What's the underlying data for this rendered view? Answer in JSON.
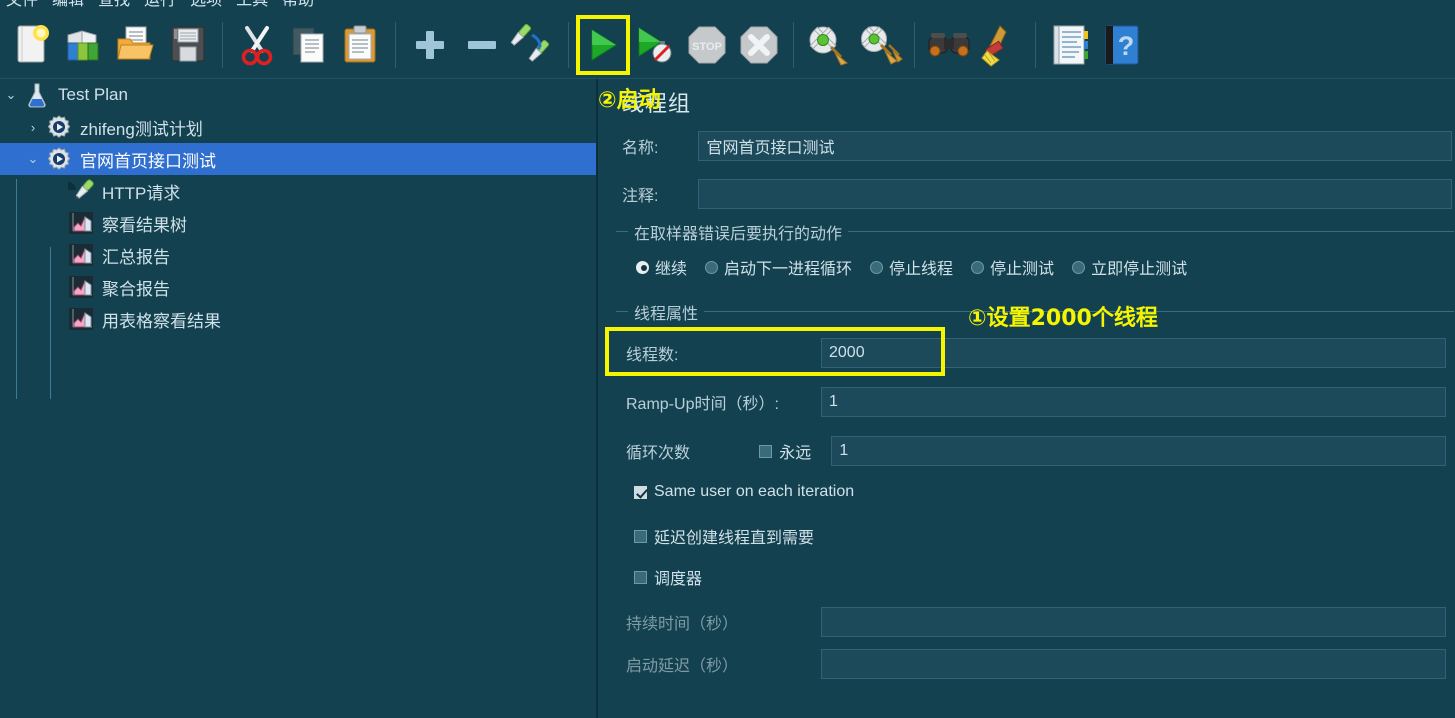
{
  "menu": {
    "items": [
      "文件",
      "编辑",
      "查找",
      "运行",
      "选项",
      "工具",
      "帮助"
    ]
  },
  "toolbar": {
    "buttons": [
      {
        "name": "new-icon",
        "label": "新建"
      },
      {
        "name": "templates-icon",
        "label": "模板"
      },
      {
        "name": "open-icon",
        "label": "打开"
      },
      {
        "name": "save-icon",
        "label": "保存"
      },
      {
        "name": "cut-icon",
        "label": "剪切"
      },
      {
        "name": "copy-icon",
        "label": "复制"
      },
      {
        "name": "paste-icon",
        "label": "粘贴"
      },
      {
        "name": "expand-all-icon",
        "label": "展开全部"
      },
      {
        "name": "collapse-all-icon",
        "label": "折叠全部"
      },
      {
        "name": "toggle-icon",
        "label": "切换"
      },
      {
        "name": "start-icon",
        "label": "启动"
      },
      {
        "name": "start-no-pauses-icon",
        "label": "无间隔启动"
      },
      {
        "name": "stop-icon",
        "label": "停止"
      },
      {
        "name": "shutdown-icon",
        "label": "关闭"
      },
      {
        "name": "clear-icon",
        "label": "清除"
      },
      {
        "name": "clear-all-icon",
        "label": "清除全部"
      },
      {
        "name": "search-icon",
        "label": "搜索"
      },
      {
        "name": "reset-search-icon",
        "label": "重置搜索"
      },
      {
        "name": "function-helper-icon",
        "label": "函数助手对话框"
      },
      {
        "name": "help-icon",
        "label": "帮助"
      }
    ]
  },
  "tree": {
    "nodes": [
      {
        "label": "Test Plan",
        "icon": "flask-icon",
        "twist": "⌄",
        "depth": 0,
        "selected": false
      },
      {
        "label": "zhifeng测试计划",
        "icon": "thread-group-icon",
        "twist": "›",
        "depth": 1,
        "selected": false
      },
      {
        "label": "官网首页接口测试",
        "icon": "thread-group-icon",
        "twist": "⌄",
        "depth": 1,
        "selected": true
      },
      {
        "label": "HTTP请求",
        "icon": "http-sampler-icon",
        "twist": "",
        "depth": 2,
        "selected": false
      },
      {
        "label": "察看结果树",
        "icon": "listener-chart-icon",
        "twist": "",
        "depth": 2,
        "selected": false
      },
      {
        "label": "汇总报告",
        "icon": "listener-chart-icon",
        "twist": "",
        "depth": 2,
        "selected": false
      },
      {
        "label": "聚合报告",
        "icon": "listener-chart-icon",
        "twist": "",
        "depth": 2,
        "selected": false
      },
      {
        "label": "用表格察看结果",
        "icon": "listener-chart-icon",
        "twist": "",
        "depth": 2,
        "selected": false
      }
    ]
  },
  "panel": {
    "title": "线程组",
    "name_label": "名称:",
    "name_value": "官网首页接口测试",
    "comment_label": "注释:",
    "comment_value": "",
    "error_action": {
      "group_title": "在取样器错误后要执行的动作",
      "options": [
        {
          "label": "继续",
          "selected": true
        },
        {
          "label": "启动下一进程循环",
          "selected": false
        },
        {
          "label": "停止线程",
          "selected": false
        },
        {
          "label": "停止测试",
          "selected": false
        },
        {
          "label": "立即停止测试",
          "selected": false
        }
      ]
    },
    "thread_props": {
      "group_title": "线程属性",
      "threads_label": "线程数:",
      "threads_value": "2000",
      "rampup_label": "Ramp-Up时间（秒）:",
      "rampup_value": "1",
      "loops_label": "循环次数",
      "forever_label": "永远",
      "forever_checked": false,
      "loops_value": "1",
      "same_user_label": "Same user on each iteration",
      "same_user_checked": true,
      "delay_create_label": "延迟创建线程直到需要",
      "delay_create_checked": false,
      "scheduler_label": "调度器",
      "scheduler_checked": false,
      "duration_label": "持续时间（秒）",
      "duration_value": "",
      "startup_delay_label": "启动延迟（秒）",
      "startup_delay_value": ""
    }
  },
  "annotations": [
    {
      "name": "annotation-threads",
      "text": "①设置2000个线程"
    },
    {
      "name": "annotation-start",
      "text": "②启动"
    }
  ],
  "colors": {
    "background": "#14414f",
    "selection": "#2f6fd0",
    "field": "#1d4a5a",
    "highlight": "#f5f500",
    "text": "#cfe1e8"
  }
}
